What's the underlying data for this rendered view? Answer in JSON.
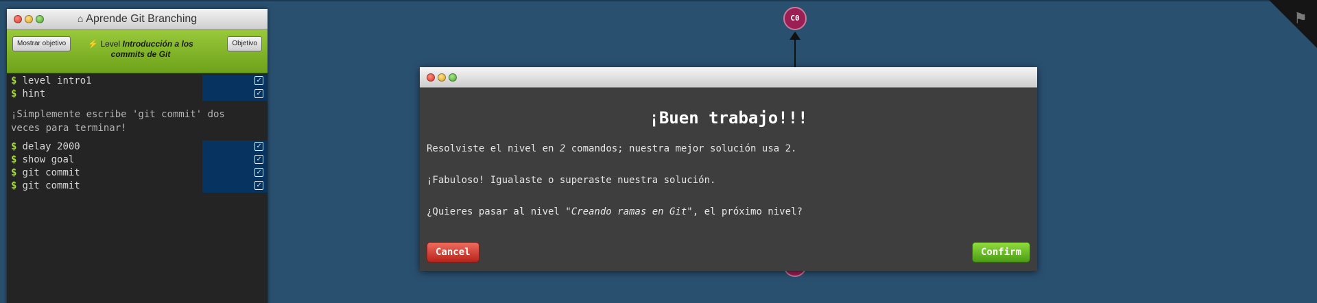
{
  "panel": {
    "title": "Aprende Git Branching",
    "icon": "home-icon",
    "show_goal_label": "Mostrar objetivo",
    "level_prefix": "Level",
    "level_name": "Introducción a los commits de Git",
    "goal_label": "Objetivo"
  },
  "terminal": {
    "commands_top": [
      "level intro1",
      "hint"
    ],
    "hint_message": "¡Simplemente escribe 'git commit' dos veces para terminar!",
    "commands_bottom": [
      "delay 2000",
      "show goal",
      "git commit",
      "git commit"
    ],
    "prompt": "$"
  },
  "graph": {
    "node_top_label": "C0"
  },
  "modal": {
    "heading": "¡Buen trabajo!!!",
    "line1_pre": "Resolviste el nivel en ",
    "line1_count": "2",
    "line1_post": " comandos; nuestra mejor solución usa 2.",
    "line2": "¡Fabuloso! Igualaste o superaste nuestra solución.",
    "line3_pre": "¿Quieres pasar al nivel \"",
    "line3_level": "Creando ramas en Git",
    "line3_post": "\", el próximo nivel?",
    "cancel_label": "Cancel",
    "confirm_label": "Confirm"
  },
  "colors": {
    "background": "#2a5070",
    "level_bar": "#7fb22a",
    "node": "#9b1f55",
    "cancel": "#c9302c",
    "confirm": "#5cb82a"
  }
}
